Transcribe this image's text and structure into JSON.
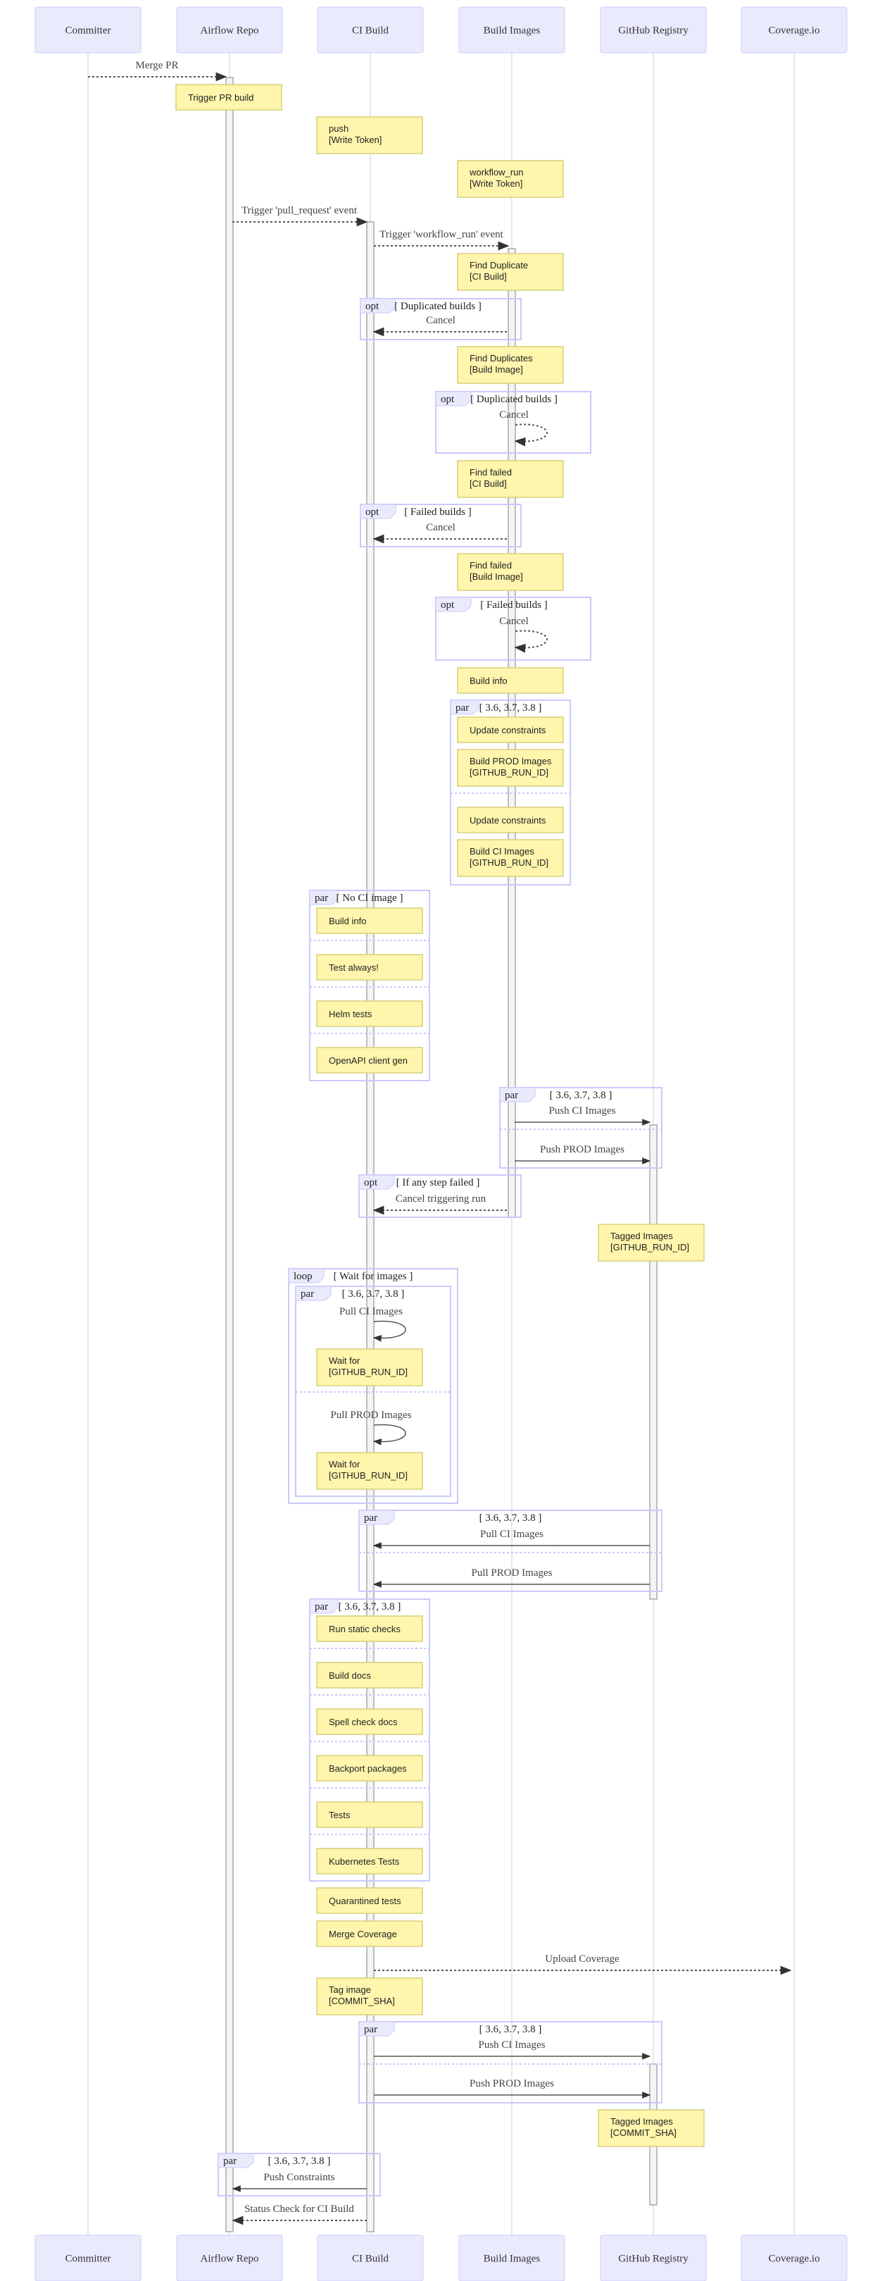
{
  "diagram": {
    "type": "sequence",
    "actors": [
      {
        "id": "committer",
        "label": "Committer"
      },
      {
        "id": "repo",
        "label": "Airflow Repo"
      },
      {
        "id": "ci",
        "label": "CI Build"
      },
      {
        "id": "build",
        "label": "Build Images"
      },
      {
        "id": "registry",
        "label": "GitHub Registry"
      },
      {
        "id": "coverage",
        "label": "Coverage.io"
      }
    ],
    "messages": [
      {
        "id": "m1",
        "from": "committer",
        "to": "repo",
        "label": "Merge PR",
        "style": "dotted"
      },
      {
        "id": "m2",
        "from": "repo",
        "to": "ci",
        "label": "Trigger 'pull_request' event",
        "style": "dotted"
      },
      {
        "id": "m3",
        "from": "ci",
        "to": "build",
        "label": "Trigger 'workflow_run' event",
        "style": "dotted"
      },
      {
        "id": "m4",
        "from": "build",
        "to": "ci",
        "label": "Cancel",
        "style": "dotted"
      },
      {
        "id": "m5",
        "from": "build",
        "to": "build",
        "label": "Cancel",
        "style": "dotted"
      },
      {
        "id": "m6",
        "from": "build",
        "to": "ci",
        "label": "Cancel",
        "style": "dotted"
      },
      {
        "id": "m7",
        "from": "build",
        "to": "build",
        "label": "Cancel",
        "style": "dotted"
      },
      {
        "id": "m8",
        "from": "build",
        "to": "registry",
        "label": "Push CI Images",
        "style": "solid"
      },
      {
        "id": "m9",
        "from": "build",
        "to": "registry",
        "label": "Push PROD Images",
        "style": "solid"
      },
      {
        "id": "m10",
        "from": "build",
        "to": "ci",
        "label": "Cancel triggering run",
        "style": "dotted"
      },
      {
        "id": "m11",
        "from": "ci",
        "to": "ci",
        "label": "Pull CI Images",
        "style": "solid"
      },
      {
        "id": "m12",
        "from": "ci",
        "to": "ci",
        "label": "Pull PROD Images",
        "style": "solid"
      },
      {
        "id": "m13",
        "from": "registry",
        "to": "ci",
        "label": "Pull CI Images",
        "style": "solid"
      },
      {
        "id": "m14",
        "from": "registry",
        "to": "ci",
        "label": "Pull PROD Images",
        "style": "solid"
      },
      {
        "id": "m15",
        "from": "ci",
        "to": "coverage",
        "label": "Upload Coverage",
        "style": "dotted"
      },
      {
        "id": "m16",
        "from": "ci",
        "to": "registry",
        "label": "Push CI Images",
        "style": "solid"
      },
      {
        "id": "m17",
        "from": "ci",
        "to": "registry",
        "label": "Push PROD Images",
        "style": "solid"
      },
      {
        "id": "m18",
        "from": "ci",
        "to": "repo",
        "label": "Push Constraints",
        "style": "solid"
      },
      {
        "id": "m19",
        "from": "ci",
        "to": "repo",
        "label": "Status Check for CI Build",
        "style": "dotted"
      }
    ],
    "notes": [
      {
        "id": "n1",
        "over": "repo",
        "lines": [
          "Trigger PR build"
        ]
      },
      {
        "id": "n2",
        "over": "ci",
        "lines": [
          "push",
          "[Write Token]"
        ]
      },
      {
        "id": "n3",
        "over": "build",
        "lines": [
          "workflow_run",
          "[Write Token]"
        ]
      },
      {
        "id": "n4",
        "over": "build",
        "lines": [
          "Find Duplicate",
          "[CI Build]"
        ]
      },
      {
        "id": "n5",
        "over": "build",
        "lines": [
          "Find Duplicates",
          "[Build Image]"
        ]
      },
      {
        "id": "n6",
        "over": "build",
        "lines": [
          "Find failed",
          "[CI Build]"
        ]
      },
      {
        "id": "n7",
        "over": "build",
        "lines": [
          "Find failed",
          "[Build Image]"
        ]
      },
      {
        "id": "n8",
        "over": "build",
        "lines": [
          "Build info"
        ]
      },
      {
        "id": "n9",
        "over": "build",
        "lines": [
          "Update constraints"
        ]
      },
      {
        "id": "n10",
        "over": "build",
        "lines": [
          "Build PROD Images",
          "[GITHUB_RUN_ID]"
        ]
      },
      {
        "id": "n11",
        "over": "build",
        "lines": [
          "Update constraints"
        ]
      },
      {
        "id": "n12",
        "over": "build",
        "lines": [
          "Build CI Images",
          "[GITHUB_RUN_ID]"
        ]
      },
      {
        "id": "n13",
        "over": "ci",
        "lines": [
          "Build info"
        ]
      },
      {
        "id": "n14",
        "over": "ci",
        "lines": [
          "Test always!"
        ]
      },
      {
        "id": "n15",
        "over": "ci",
        "lines": [
          "Helm tests"
        ]
      },
      {
        "id": "n16",
        "over": "ci",
        "lines": [
          "OpenAPI client gen"
        ]
      },
      {
        "id": "n17",
        "over": "registry",
        "lines": [
          "Tagged Images",
          "[GITHUB_RUN_ID]"
        ]
      },
      {
        "id": "n18",
        "over": "ci",
        "lines": [
          "Wait for",
          "[GITHUB_RUN_ID]"
        ]
      },
      {
        "id": "n19",
        "over": "ci",
        "lines": [
          "Wait for",
          "[GITHUB_RUN_ID]"
        ]
      },
      {
        "id": "n20",
        "over": "ci",
        "lines": [
          "Run static checks"
        ]
      },
      {
        "id": "n21",
        "over": "ci",
        "lines": [
          "Build docs"
        ]
      },
      {
        "id": "n22",
        "over": "ci",
        "lines": [
          "Spell check docs"
        ]
      },
      {
        "id": "n23",
        "over": "ci",
        "lines": [
          "Backport packages"
        ]
      },
      {
        "id": "n24",
        "over": "ci",
        "lines": [
          "Tests"
        ]
      },
      {
        "id": "n25",
        "over": "ci",
        "lines": [
          "Kubernetes Tests"
        ]
      },
      {
        "id": "n26",
        "over": "ci",
        "lines": [
          "Quarantined tests"
        ]
      },
      {
        "id": "n27",
        "over": "ci",
        "lines": [
          "Merge Coverage"
        ]
      },
      {
        "id": "n28",
        "over": "ci",
        "lines": [
          "Tag image",
          "[COMMIT_SHA]"
        ]
      },
      {
        "id": "n29",
        "over": "registry",
        "lines": [
          "Tagged Images",
          "[COMMIT_SHA]"
        ]
      }
    ],
    "frames": [
      {
        "id": "f1",
        "kind": "opt",
        "condition": "[ Duplicated builds ]"
      },
      {
        "id": "f2",
        "kind": "opt",
        "condition": "[ Duplicated builds ]"
      },
      {
        "id": "f3",
        "kind": "opt",
        "condition": "[ Failed builds ]"
      },
      {
        "id": "f4",
        "kind": "opt",
        "condition": "[ Failed builds ]"
      },
      {
        "id": "f5",
        "kind": "par",
        "condition": "[ 3.6, 3.7, 3.8 ]"
      },
      {
        "id": "f6",
        "kind": "par",
        "condition": "[ No CI image ]"
      },
      {
        "id": "f7",
        "kind": "par",
        "condition": "[ 3.6, 3.7, 3.8 ]"
      },
      {
        "id": "f8",
        "kind": "opt",
        "condition": "[ If any step failed ]"
      },
      {
        "id": "f9",
        "kind": "loop",
        "condition": "[ Wait for images ]"
      },
      {
        "id": "f10",
        "kind": "par",
        "condition": "[ 3.6, 3.7, 3.8 ]"
      },
      {
        "id": "f11",
        "kind": "par",
        "condition": "[ 3.6, 3.7, 3.8 ]"
      },
      {
        "id": "f12",
        "kind": "par",
        "condition": "[ 3.6, 3.7, 3.8 ]"
      },
      {
        "id": "f13",
        "kind": "par",
        "condition": "[ 3.6, 3.7, 3.8 ]"
      },
      {
        "id": "f14",
        "kind": "par",
        "condition": "[ 3.6, 3.7, 3.8 ]"
      }
    ]
  }
}
